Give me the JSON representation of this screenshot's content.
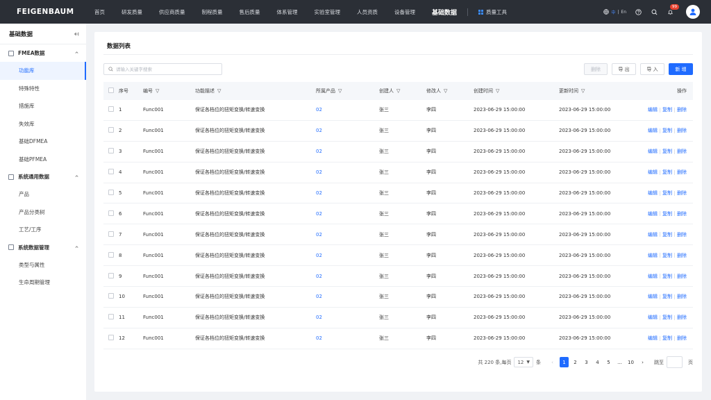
{
  "brand": "FEIGENBAUM",
  "nav": {
    "items": [
      "首页",
      "研发质量",
      "供应商质量",
      "制程质量",
      "售后质量",
      "体系管理",
      "实验室管理",
      "人员资质",
      "设备管理",
      "基础数据"
    ],
    "active": "基础数据",
    "tool": "质量工具",
    "lang_cn": "中",
    "lang_sep": "|",
    "lang_en": "En",
    "badge": "99",
    "colors": {
      "topbar": "#2b2f36",
      "accent": "#1f6bff"
    }
  },
  "sidebar": {
    "title": "基础数据",
    "groups": [
      {
        "label": "FMEA数据",
        "items": [
          "功能库",
          "特殊特性",
          "措施库",
          "失效库",
          "基础DFMEA",
          "基础PFMEA"
        ]
      },
      {
        "label": "系统通用数据",
        "items": [
          "产品",
          "产品分类树",
          "工艺/工序"
        ]
      },
      {
        "label": "系统数据管理",
        "items": [
          "类型与属性",
          "生命周期管理"
        ]
      }
    ],
    "active_item": "功能库"
  },
  "main": {
    "title": "数据列表",
    "search_placeholder": "请输入关键字搜索",
    "buttons": {
      "delete": "删除",
      "export": "导 出",
      "import": "导 入",
      "add": "新 增"
    },
    "columns": {
      "idx": "序号",
      "code": "编号",
      "desc": "功能描述",
      "product": "所属产品",
      "creator": "创建人",
      "modifier": "修改人",
      "ctime": "创建时间",
      "utime": "更新时间",
      "ops": "操作"
    },
    "op_labels": [
      "编辑",
      "复制",
      "删除"
    ],
    "rows": [
      {
        "idx": "1",
        "code": "Func001",
        "desc": "保证各档位的扭矩变换/转速变换",
        "product": "02",
        "creator": "张三",
        "modifier": "李四",
        "ctime": "2023-06-29 15:00:00",
        "utime": "2023-06-29 15:00:00"
      },
      {
        "idx": "2",
        "code": "Func001",
        "desc": "保证各档位的扭矩变换/转速变换",
        "product": "02",
        "creator": "张三",
        "modifier": "李四",
        "ctime": "2023-06-29 15:00:00",
        "utime": "2023-06-29 15:00:00"
      },
      {
        "idx": "3",
        "code": "Func001",
        "desc": "保证各档位的扭矩变换/转速变换",
        "product": "02",
        "creator": "张三",
        "modifier": "李四",
        "ctime": "2023-06-29 15:00:00",
        "utime": "2023-06-29 15:00:00"
      },
      {
        "idx": "4",
        "code": "Func001",
        "desc": "保证各档位的扭矩变换/转速变换",
        "product": "02",
        "creator": "张三",
        "modifier": "李四",
        "ctime": "2023-06-29 15:00:00",
        "utime": "2023-06-29 15:00:00"
      },
      {
        "idx": "5",
        "code": "Func001",
        "desc": "保证各档位的扭矩变换/转速变换",
        "product": "02",
        "creator": "张三",
        "modifier": "李四",
        "ctime": "2023-06-29 15:00:00",
        "utime": "2023-06-29 15:00:00"
      },
      {
        "idx": "6",
        "code": "Func001",
        "desc": "保证各档位的扭矩变换/转速变换",
        "product": "02",
        "creator": "张三",
        "modifier": "李四",
        "ctime": "2023-06-29 15:00:00",
        "utime": "2023-06-29 15:00:00"
      },
      {
        "idx": "7",
        "code": "Func001",
        "desc": "保证各档位的扭矩变换/转速变换",
        "product": "02",
        "creator": "张三",
        "modifier": "李四",
        "ctime": "2023-06-29 15:00:00",
        "utime": "2023-06-29 15:00:00"
      },
      {
        "idx": "8",
        "code": "Func001",
        "desc": "保证各档位的扭矩变换/转速变换",
        "product": "02",
        "creator": "张三",
        "modifier": "李四",
        "ctime": "2023-06-29 15:00:00",
        "utime": "2023-06-29 15:00:00"
      },
      {
        "idx": "9",
        "code": "Func001",
        "desc": "保证各档位的扭矩变换/转速变换",
        "product": "02",
        "creator": "张三",
        "modifier": "李四",
        "ctime": "2023-06-29 15:00:00",
        "utime": "2023-06-29 15:00:00"
      },
      {
        "idx": "10",
        "code": "Func001",
        "desc": "保证各档位的扭矩变换/转速变换",
        "product": "02",
        "creator": "张三",
        "modifier": "李四",
        "ctime": "2023-06-29 15:00:00",
        "utime": "2023-06-29 15:00:00"
      },
      {
        "idx": "11",
        "code": "Func001",
        "desc": "保证各档位的扭矩变换/转速变换",
        "product": "02",
        "creator": "张三",
        "modifier": "李四",
        "ctime": "2023-06-29 15:00:00",
        "utime": "2023-06-29 15:00:00"
      },
      {
        "idx": "12",
        "code": "Func001",
        "desc": "保证各档位的扭矩变换/转速变换",
        "product": "02",
        "creator": "张三",
        "modifier": "李四",
        "ctime": "2023-06-29 15:00:00",
        "utime": "2023-06-29 15:00:00"
      }
    ],
    "pagination": {
      "total_text": "共 220 条,每页",
      "page_size": "12",
      "unit": "条",
      "pages": [
        "1",
        "2",
        "3",
        "4",
        "5",
        "...",
        "10"
      ],
      "current": "1",
      "jump_label": "跳至",
      "page_unit": "页"
    }
  }
}
